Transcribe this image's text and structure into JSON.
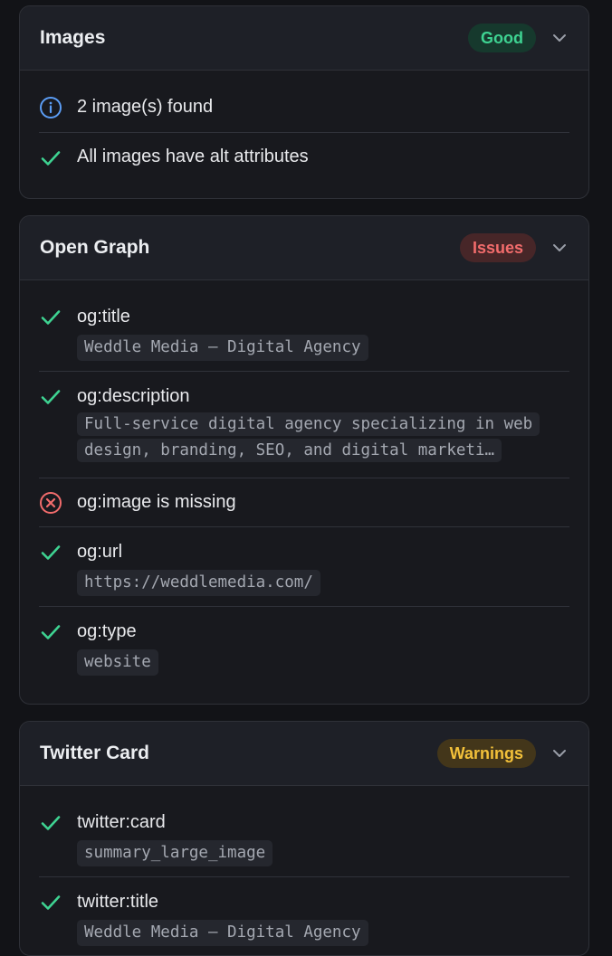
{
  "colors": {
    "success": "#3ed392",
    "error": "#f26c6c",
    "info": "#5b9df5",
    "warning": "#f3c13a"
  },
  "panels": [
    {
      "title": "Images",
      "badge": "Good",
      "badge_status": "good",
      "items": [
        {
          "status": "info-icon",
          "label": "2 image(s) found"
        },
        {
          "status": "check-icon",
          "label": "All images have alt attributes"
        }
      ]
    },
    {
      "title": "Open Graph",
      "badge": "Issues",
      "badge_status": "issues",
      "items": [
        {
          "status": "check-icon",
          "label": "og:title",
          "value": "Weddle Media — Digital Agency"
        },
        {
          "status": "check-icon",
          "label": "og:description",
          "value": "Full-service digital agency specializing in web design, branding, SEO, and digital marketi…"
        },
        {
          "status": "error-icon",
          "label": "og:image is missing"
        },
        {
          "status": "check-icon",
          "label": "og:url",
          "value": "https://weddlemedia.com/"
        },
        {
          "status": "check-icon",
          "label": "og:type",
          "value": "website"
        }
      ]
    },
    {
      "title": "Twitter Card",
      "badge": "Warnings",
      "badge_status": "warnings",
      "items": [
        {
          "status": "check-icon",
          "label": "twitter:card",
          "value": "summary_large_image"
        },
        {
          "status": "check-icon",
          "label": "twitter:title",
          "value": "Weddle Media — Digital Agency"
        }
      ]
    }
  ]
}
